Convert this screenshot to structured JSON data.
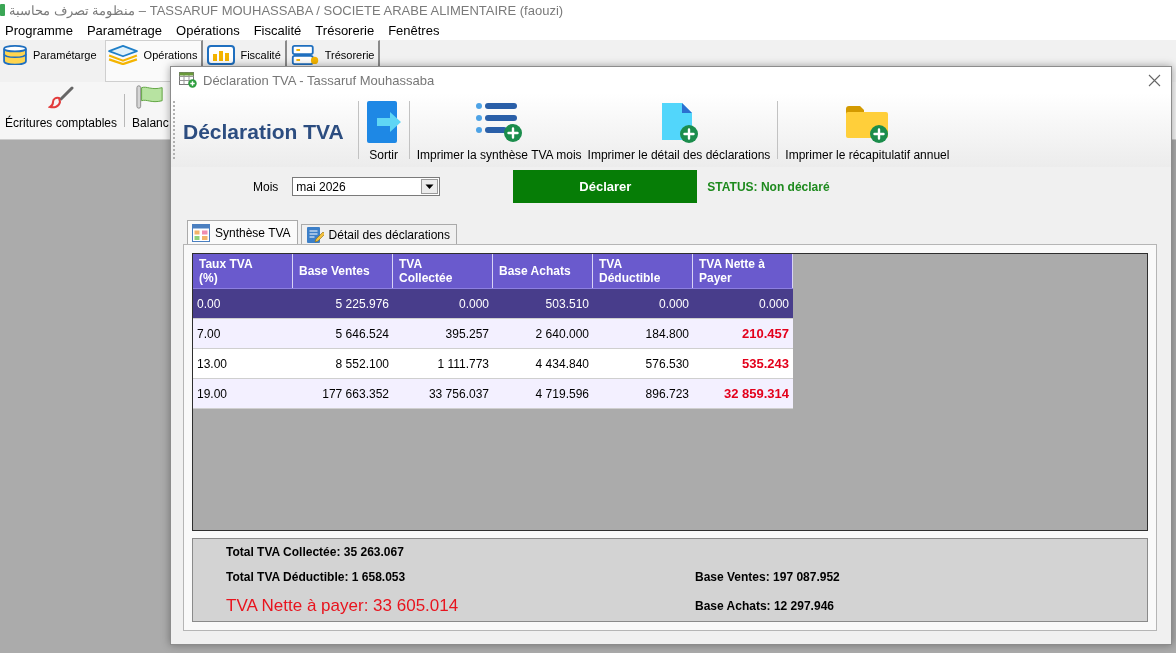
{
  "app_window": {
    "title": "منظومة تصرف محاسبة – TASSARUF MOUHASSABA / SOCIETE ARABE ALIMENTAIRE (faouzi)"
  },
  "menu": [
    "Programme",
    "Paramétrage",
    "Opérations",
    "Fiscalité",
    "Trésorerie",
    "Fenêtres"
  ],
  "ribbon_tabs": [
    {
      "label": "Paramétarge",
      "selected": false
    },
    {
      "label": "Opérations",
      "selected": true
    },
    {
      "label": "Fiscalité",
      "selected": false
    },
    {
      "label": "Trésorerie",
      "selected": false
    }
  ],
  "toolbar": [
    "Écritures comptables",
    "Balanc"
  ],
  "dialog": {
    "title": "Déclaration TVA - Tassaruf Mouhassaba",
    "heading": "Déclaration TVA",
    "toolbar": [
      "Sortir",
      "Imprimer la synthèse TVA mois",
      "Imprimer le détail des déclarations",
      "Imprimer le récapitulatif annuel"
    ],
    "month": {
      "label": "Mois",
      "value": "mai 2026"
    },
    "declare_button": "Déclarer",
    "status": "STATUS: Non déclaré",
    "tabs": [
      {
        "label": "Synthèse TVA",
        "selected": true
      },
      {
        "label": "Détail des déclarations",
        "selected": false
      }
    ],
    "table": {
      "columns": [
        {
          "label": "Taux TVA (%)",
          "kind": "rate"
        },
        {
          "label": "Base Ventes",
          "kind": "amount"
        },
        {
          "label": "TVA Collectée",
          "kind": "amount"
        },
        {
          "label": "Base Achats",
          "kind": "amount"
        },
        {
          "label": "TVA Déductible",
          "kind": "amount"
        },
        {
          "label": "TVA Nette à Payer",
          "kind": "net"
        }
      ],
      "rows": [
        {
          "selected": true,
          "cells": [
            "0.00",
            "5 225.976",
            "0.000",
            "503.510",
            "0.000",
            "0.000"
          ]
        },
        {
          "selected": false,
          "cells": [
            "7.00",
            "5 646.524",
            "395.257",
            "2 640.000",
            "184.800",
            "210.457"
          ]
        },
        {
          "selected": false,
          "cells": [
            "13.00",
            "8 552.100",
            "1 111.773",
            "4 434.840",
            "576.530",
            "535.243"
          ]
        },
        {
          "selected": false,
          "cells": [
            "19.00",
            "177 663.352",
            "33 756.037",
            "4 719.596",
            "896.723",
            "32 859.314"
          ]
        }
      ]
    },
    "summary": {
      "total_collected": "Total TVA Collectée: 35 263.067",
      "total_deductible": "Total TVA Déductible: 1 658.053",
      "net_to_pay": "TVA Nette à payer: 33 605.014",
      "base_sales": "Base Ventes: 197 087.952",
      "base_purchases": "Base Achats: 12 297.946"
    }
  }
}
